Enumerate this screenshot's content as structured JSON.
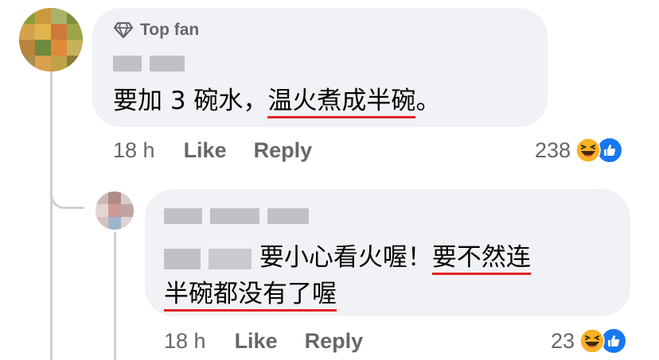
{
  "comment": {
    "badge": "Top fan",
    "text_plain": "要加 3 碗水，",
    "text_underlined": "温火煮成半碗",
    "text_end": "。",
    "time": "18 h",
    "like_label": "Like",
    "reply_label": "Reply",
    "reaction_count": "238",
    "colors": {
      "bubble": "#f0f2f5",
      "underline": "#e02424",
      "like_blue": "#1877f2"
    }
  },
  "reply": {
    "text_plain": " 要小心看火喔！",
    "text_underlined_1": "要不然连",
    "text_underlined_2": "半碗都没有了喔",
    "time": "18 h",
    "like_label": "Like",
    "reply_label": "Reply",
    "reaction_count": "23"
  },
  "icons": [
    "diamond-icon",
    "laugh-emoji-icon",
    "like-thumb-icon"
  ]
}
